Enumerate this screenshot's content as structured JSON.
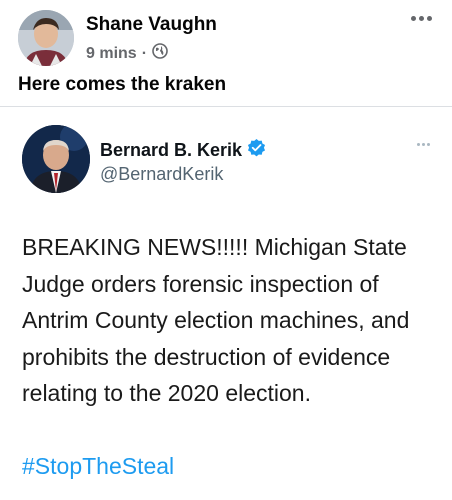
{
  "post": {
    "author": "Shane Vaughn",
    "time": "9 mins",
    "separator": "·",
    "text": "Here comes the kraken",
    "privacy_icon": "globe-icon",
    "more_icon": "ellipsis-icon"
  },
  "tweet": {
    "name": "Bernard B. Kerik",
    "handle": "@BernardKerik",
    "verified_icon": "verified-badge-icon",
    "body": "BREAKING NEWS!!!!! Michigan State Judge orders forensic inspection of Antrim County election machines, and prohibits the destruction of evidence relating to the 2020 election.",
    "hashtag": "#StopTheSteal",
    "more_icon": "ellipsis-icon"
  },
  "colors": {
    "link": "#1d9bf0",
    "verified": "#1d9bf0",
    "meta_gray": "#65676b"
  }
}
